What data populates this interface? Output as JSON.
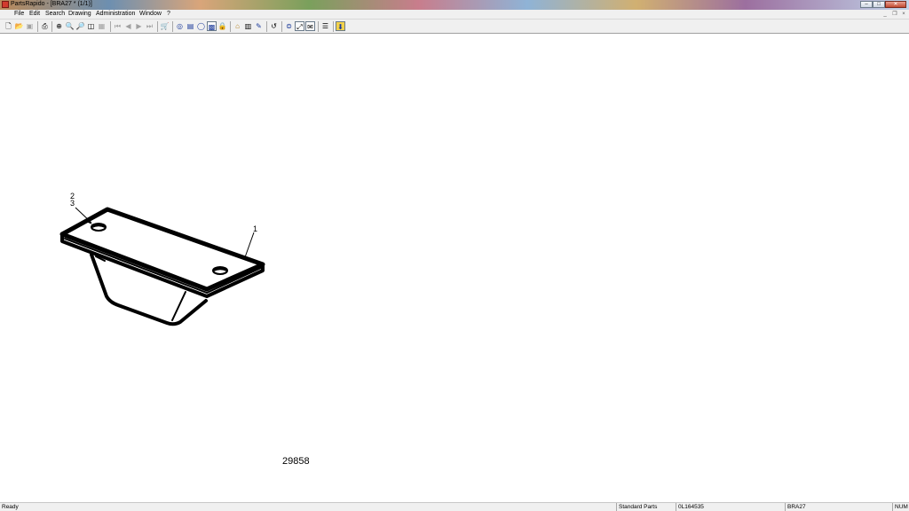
{
  "window": {
    "title": "PartsRapido - [BRA27 * (1/1)]",
    "controls": {
      "minimize": "–",
      "maximize": "□",
      "close": "✕"
    }
  },
  "menu": {
    "items": [
      "File",
      "Edit",
      "Search",
      "Drawing",
      "Administration",
      "Window",
      "?"
    ],
    "mdi_controls": {
      "minimize": "_",
      "restore": "❐",
      "close": "×"
    }
  },
  "toolbar": {
    "buttons": [
      {
        "icon": "new-document-icon",
        "glyph": "🗋"
      },
      {
        "icon": "open-folder-icon",
        "glyph": "📂"
      },
      {
        "icon": "save-icon",
        "glyph": "▣"
      },
      {
        "icon": "print-icon",
        "glyph": "⎙"
      },
      {
        "icon": "zoom-fit-icon",
        "glyph": "⊕"
      },
      {
        "icon": "zoom-in-icon",
        "glyph": "🔍"
      },
      {
        "icon": "zoom-out-icon",
        "glyph": "🔎"
      },
      {
        "icon": "zoom-page-icon",
        "glyph": "◫"
      },
      {
        "icon": "zoom-window-icon",
        "glyph": "▦"
      },
      {
        "icon": "first-page-icon",
        "glyph": "⏮"
      },
      {
        "icon": "previous-page-icon",
        "glyph": "◀"
      },
      {
        "icon": "next-page-icon",
        "glyph": "▶"
      },
      {
        "icon": "last-page-icon",
        "glyph": "⏭"
      },
      {
        "icon": "cart-icon",
        "glyph": "🛒"
      },
      {
        "icon": "binoculars-icon",
        "glyph": "◎"
      },
      {
        "icon": "parts-list-icon",
        "glyph": "▤"
      },
      {
        "icon": "circle-icon",
        "glyph": "◯"
      },
      {
        "icon": "image-icon",
        "glyph": "▩"
      },
      {
        "icon": "lock-icon",
        "glyph": "🔒"
      },
      {
        "icon": "home-icon",
        "glyph": "⌂"
      },
      {
        "icon": "bookmark-icon",
        "glyph": "▥"
      },
      {
        "icon": "pen-icon",
        "glyph": "✎"
      },
      {
        "icon": "refresh-icon",
        "glyph": "↺"
      },
      {
        "icon": "globe-icon",
        "glyph": "⊜"
      },
      {
        "icon": "fullscreen-icon",
        "glyph": "⤢"
      },
      {
        "icon": "mail-icon",
        "glyph": "✉"
      },
      {
        "icon": "list-icon",
        "glyph": "☰"
      },
      {
        "icon": "help-icon",
        "glyph": "⬇"
      }
    ]
  },
  "drawing": {
    "callouts": [
      "1",
      "2",
      "3"
    ],
    "drawing_number": "29858"
  },
  "status": {
    "ready": "Ready",
    "category": "Standard Parts",
    "part_number": "0L164535",
    "catalog": "BRA27",
    "numlock": "NUM"
  }
}
